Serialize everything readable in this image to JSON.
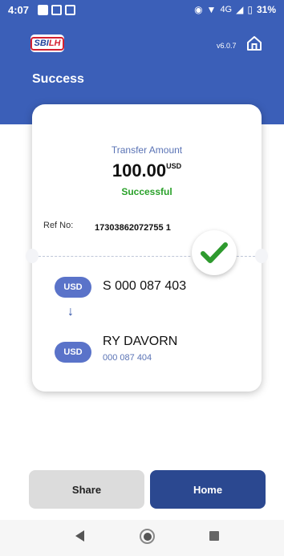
{
  "status_bar": {
    "time": "4:07",
    "network": "4G",
    "battery": "31%"
  },
  "header": {
    "logo_text_1": "SBI",
    "logo_text_2": "LH",
    "version": "v6.0.7",
    "title": "Success"
  },
  "receipt": {
    "amount_label": "Transfer Amount",
    "amount": "100.00",
    "currency": "USD",
    "status": "Successful",
    "ref_label": "Ref No:",
    "ref_value": "17303862072755 1",
    "from": {
      "currency": "USD",
      "account": "S 000 087 403"
    },
    "to": {
      "currency": "USD",
      "name": "RY DAVORN",
      "account": "000 087 404"
    }
  },
  "actions": {
    "share_label": "Share",
    "home_label": "Home"
  },
  "colors": {
    "primary": "#3b5fb8",
    "success": "#2aa12a",
    "button_dark": "#2b4890"
  }
}
